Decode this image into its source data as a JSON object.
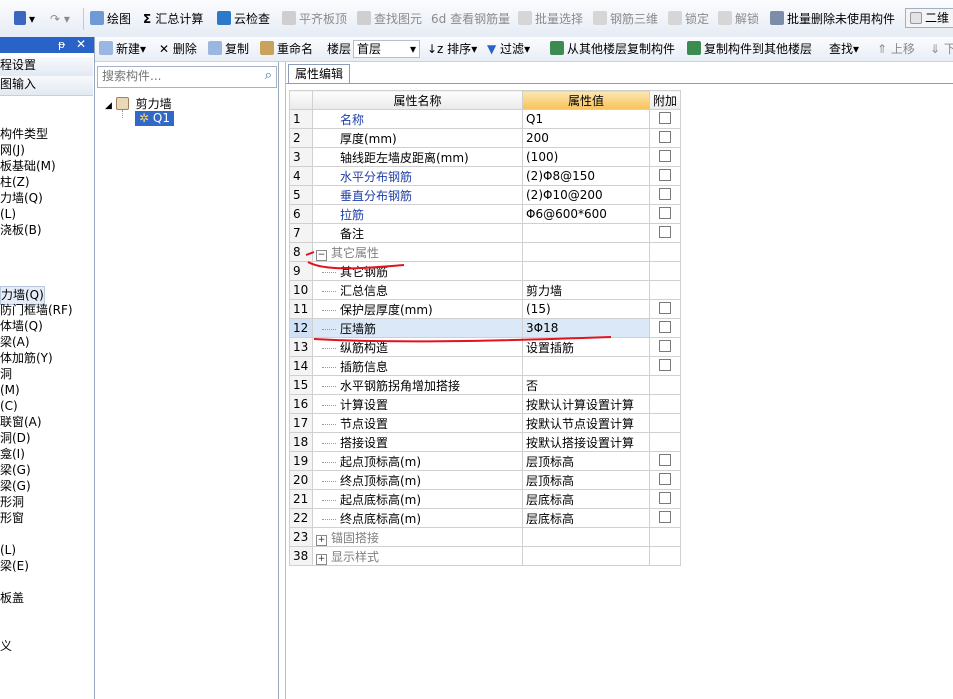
{
  "toolbar": {
    "draw": "绘图",
    "sum_calc": "汇总计算",
    "cloud_check": "云检查",
    "flat_slab": "平齐板顶",
    "find_element": "查找图元",
    "view_rebar": "查看钢筋量",
    "batch_select": "批量选择",
    "rebar_3d": "钢筋三维",
    "lock": "锁定",
    "unlock": "解锁",
    "batch_delete": "批量删除未使用构件",
    "view_2d": "二维"
  },
  "toolbar2": {
    "new": "新建",
    "delete": "删除",
    "copy": "复制",
    "rename": "重命名",
    "floor_label": "楼层",
    "floor_value": "首层",
    "sort": "排序",
    "filter": "过滤",
    "copy_from_other": "从其他楼层复制构件",
    "copy_to_other": "复制构件到其他楼层",
    "find": "查找",
    "move_up": "上移",
    "move_down": "下"
  },
  "left_panel": {
    "items": [
      "程设置",
      "图输入",
      "构件类型",
      "网(J)",
      "板基础(M)",
      "柱(Z)",
      "力墙(Q)",
      "(L)",
      "浇板(B)",
      "力墙(Q)",
      "防门框墙(RF)",
      "体墙(Q)",
      "梁(A)",
      "体加筋(Y)",
      "洞",
      "(M)",
      "(C)",
      "联窗(A)",
      "洞(D)",
      "龛(I)",
      "梁(G)",
      "梁(G)",
      "形洞",
      "形窗",
      "(L)",
      "梁(E)",
      "板盖",
      "义"
    ]
  },
  "tree": {
    "search_placeholder": "搜索构件...",
    "root": "剪力墙",
    "child": "Q1"
  },
  "editor": {
    "tab": "属性编辑",
    "headers": [
      "属性名称",
      "属性值",
      "附加"
    ],
    "rows": [
      {
        "num": "1",
        "name": "名称",
        "value": "Q1"
      },
      {
        "num": "2",
        "name": "厚度(mm)",
        "value": "200"
      },
      {
        "num": "3",
        "name": "轴线距左墙皮距离(mm)",
        "value": "(100)"
      },
      {
        "num": "4",
        "name": "水平分布钢筋",
        "value": "(2)Φ8@150"
      },
      {
        "num": "5",
        "name": "垂直分布钢筋",
        "value": "(2)Φ10@200"
      },
      {
        "num": "6",
        "name": "拉筋",
        "value": "Φ6@600*600"
      },
      {
        "num": "7",
        "name": "备注",
        "value": ""
      },
      {
        "num": "8",
        "name": "其它属性",
        "value": ""
      },
      {
        "num": "9",
        "name": "其它钢筋",
        "value": ""
      },
      {
        "num": "10",
        "name": "汇总信息",
        "value": "剪力墙"
      },
      {
        "num": "11",
        "name": "保护层厚度(mm)",
        "value": "(15)"
      },
      {
        "num": "12",
        "name": "压墙筋",
        "value": "3Φ18"
      },
      {
        "num": "13",
        "name": "纵筋构造",
        "value": "设置插筋"
      },
      {
        "num": "14",
        "name": "插筋信息",
        "value": ""
      },
      {
        "num": "15",
        "name": "水平钢筋拐角增加搭接",
        "value": "否"
      },
      {
        "num": "16",
        "name": "计算设置",
        "value": "按默认计算设置计算"
      },
      {
        "num": "17",
        "name": "节点设置",
        "value": "按默认节点设置计算"
      },
      {
        "num": "18",
        "name": "搭接设置",
        "value": "按默认搭接设置计算"
      },
      {
        "num": "19",
        "name": "起点顶标高(m)",
        "value": "层顶标高"
      },
      {
        "num": "20",
        "name": "终点顶标高(m)",
        "value": "层顶标高"
      },
      {
        "num": "21",
        "name": "起点底标高(m)",
        "value": "层底标高"
      },
      {
        "num": "22",
        "name": "终点底标高(m)",
        "value": "层底标高"
      },
      {
        "num": "23",
        "name": "锚固搭接",
        "value": ""
      },
      {
        "num": "38",
        "name": "显示样式",
        "value": ""
      }
    ]
  },
  "colors": {
    "accent": "#2a63c7",
    "header_value": "#f7c25a",
    "annotation_red": "#e0141e"
  }
}
